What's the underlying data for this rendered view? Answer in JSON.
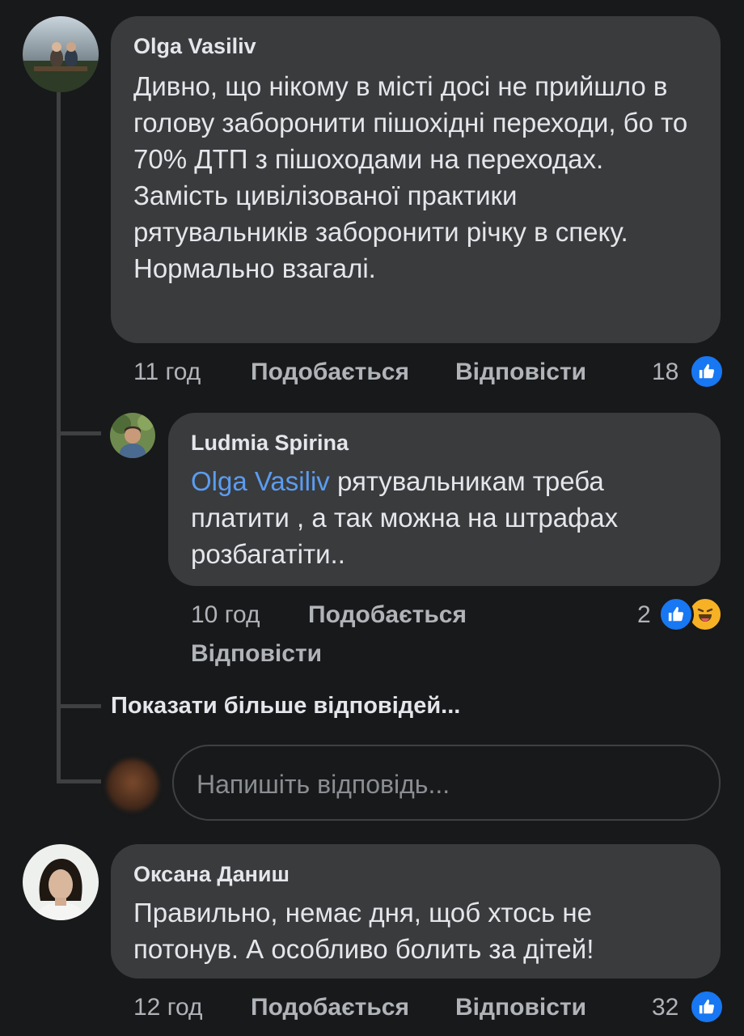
{
  "comments": [
    {
      "author": "Olga Vasiliv",
      "text": "Дивно, що нікому в місті досі не прийшло в голову заборонити пішохідні переходи, бо то 70% ДТП з пішоходами на переходах. Замість цивілізованої практики  рятувальників заборонити річку в спеку. Нормально взагалі.",
      "time": "11 год",
      "like_label": "Подобається",
      "reply_label": "Відповісти",
      "reaction_count": "18",
      "replies": [
        {
          "author": "Ludmia Spirina",
          "mention": "Olga Vasiliv",
          "text": " рятувальникам треба платити , а так можна на штрафах розбагатіти..",
          "time": "10 год",
          "like_label": "Подобається",
          "reply_label": "Відповісти",
          "reaction_count": "2"
        }
      ],
      "more_replies_label": "Показати більше відповідей...",
      "reply_placeholder": "Напишіть відповідь..."
    },
    {
      "author": "Оксана Даниш",
      "text": "Правильно, немає дня, щоб хтось не потонув. А особливо болить за дітей!",
      "time": "12 год",
      "like_label": "Подобається",
      "reply_label": "Відповісти",
      "reaction_count": "32"
    }
  ],
  "colors": {
    "background": "#18191a",
    "bubble": "#3a3b3c",
    "mention": "#5b9cf0",
    "like_blue": "#1877f2",
    "haha_yellow": "#f7b125"
  }
}
